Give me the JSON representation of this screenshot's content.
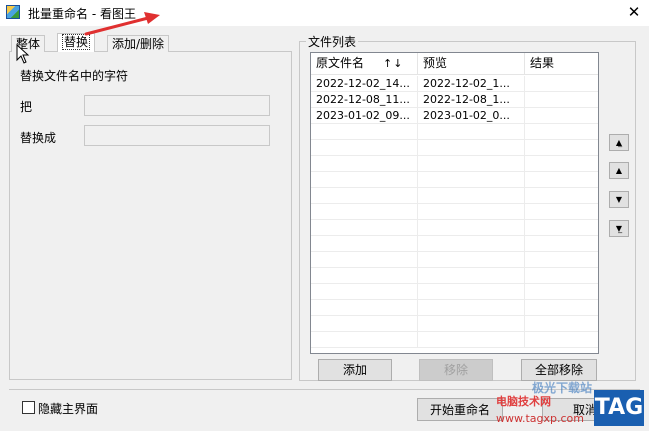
{
  "window": {
    "title": "批量重命名 - 看图王",
    "close_glyph": "✕"
  },
  "tabs": [
    {
      "label": "整体",
      "active": false
    },
    {
      "label": "替换",
      "active": true
    },
    {
      "label": "添加/删除",
      "active": false
    }
  ],
  "replace_panel": {
    "section_title": "替换文件名中的字符",
    "find_label": "把",
    "find_value": "",
    "replace_label": "替换成",
    "replace_value": ""
  },
  "file_list": {
    "group_title": "文件列表",
    "columns": [
      "原文件名",
      "预览",
      "结果"
    ],
    "sort_glyph": "↑↓",
    "rows": [
      {
        "original": "2022-12-02_14...",
        "preview": "2022-12-02_1...",
        "result": ""
      },
      {
        "original": "2022-12-08_11...",
        "preview": "2022-12-08_1...",
        "result": ""
      },
      {
        "original": "2023-01-02_09...",
        "preview": "2023-01-02_0...",
        "result": ""
      }
    ],
    "add_label": "添加",
    "remove_label": "移除",
    "remove_all_label": "全部移除"
  },
  "move_buttons": {
    "top": "▲̲",
    "up": "▲",
    "down": "▼",
    "bottom": "▼̲"
  },
  "footer": {
    "hide_main_label": "隐藏主界面",
    "hide_main_checked": false,
    "start_rename_label": "开始重命名",
    "close_label": "取消"
  },
  "watermark": {
    "site_name": "电脑技术网",
    "url": "www.tagxp.com",
    "logo": "TAG",
    "overlay_text": "极光下载站"
  },
  "colors": {
    "window_bg": "#f0f0f0",
    "arrow_red": "#e03030",
    "logo_blue": "#1a5fb0"
  }
}
